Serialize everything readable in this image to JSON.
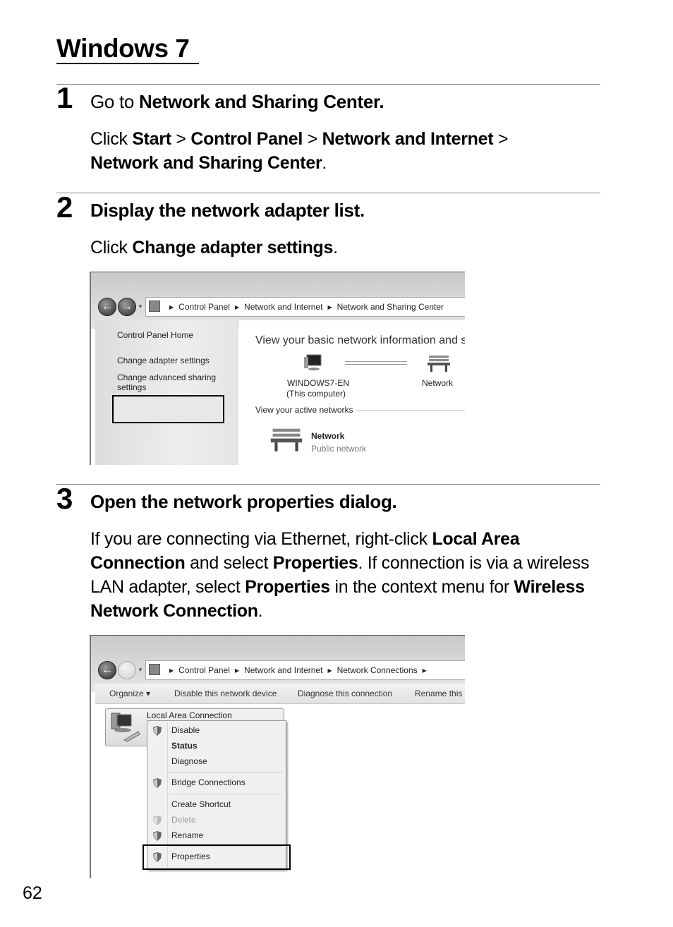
{
  "page": {
    "title": "Windows 7",
    "page_number": "62"
  },
  "steps": [
    {
      "number": "1",
      "heading_prefix": "Go to ",
      "heading_bold": "Network and Sharing Center.",
      "body": {
        "p1": "Click ",
        "b1": "Start",
        "p2": " > ",
        "b2": "Control Panel",
        "p3": " > ",
        "b3": "Network and Internet",
        "p4": " > ",
        "b4": "Network and Sharing Center",
        "p5": "."
      }
    },
    {
      "number": "2",
      "heading": "Display the network adapter list.",
      "body": {
        "p1": "Click ",
        "b1": "Change adapter settings",
        "p2": "."
      }
    },
    {
      "number": "3",
      "heading": "Open the network properties dialog.",
      "body": {
        "p1": "If you are connecting via Ethernet, right-click ",
        "b1": "Local Area Connection",
        "p2": " and select ",
        "b2": "Properties",
        "p3": ". If connection is via a wireless LAN adapter, select ",
        "b3": "Properties",
        "p4": " in the context menu for ",
        "b4": "Wireless Network Connection",
        "p5": "."
      }
    }
  ],
  "screenshot1": {
    "breadcrumb": [
      "Control Panel",
      "Network and Internet",
      "Network and Sharing Center"
    ],
    "left_pane": {
      "home": "Control Panel Home",
      "change_adapter": "Change adapter settings",
      "change_sharing": "Change advanced sharing settings"
    },
    "main": {
      "heading": "View your basic network information and s",
      "computer_name": "WINDOWS7-EN",
      "computer_sub": "(This computer)",
      "network_label": "Network",
      "active_networks": "View your active networks",
      "active_network_name": "Network",
      "active_network_type": "Public network"
    }
  },
  "screenshot2": {
    "breadcrumb": [
      "Control Panel",
      "Network and Internet",
      "Network Connections"
    ],
    "toolbar": {
      "organize": "Organize ▾",
      "disable": "Disable this network device",
      "diagnose": "Diagnose this connection",
      "rename": "Rename this c"
    },
    "connection_name": "Local Area Connection",
    "context_menu": {
      "disable": "Disable",
      "status": "Status",
      "diagnose": "Diagnose",
      "bridge": "Bridge Connections",
      "shortcut": "Create Shortcut",
      "delete": "Delete",
      "rename": "Rename",
      "properties": "Properties"
    }
  }
}
